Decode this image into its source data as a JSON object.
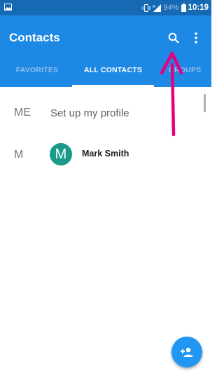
{
  "status_bar": {
    "battery": "94%",
    "time": "10:19",
    "icons": [
      "image-icon",
      "vibrate-icon",
      "signal-icon",
      "battery-icon"
    ]
  },
  "app_bar": {
    "title": "Contacts",
    "search_icon": "search-icon",
    "more_icon": "more-vert-icon"
  },
  "tabs": [
    {
      "label": "FAVORITES",
      "active": false
    },
    {
      "label": "ALL CONTACTS",
      "active": true
    },
    {
      "label": "GROUPS",
      "active": false
    }
  ],
  "list": {
    "me_section_letter": "ME",
    "me_row_text": "Set up my profile",
    "contacts": [
      {
        "section_letter": "M",
        "avatar_letter": "M",
        "name": "Mark Smith"
      }
    ]
  },
  "fab": {
    "icon": "add-contact-icon"
  },
  "colors": {
    "status_bar": "#1669b3",
    "app_bar": "#1e88e5",
    "avatar": "#1a9b8a",
    "fab": "#2196f3",
    "annotation_arrow": "#e6007e"
  }
}
